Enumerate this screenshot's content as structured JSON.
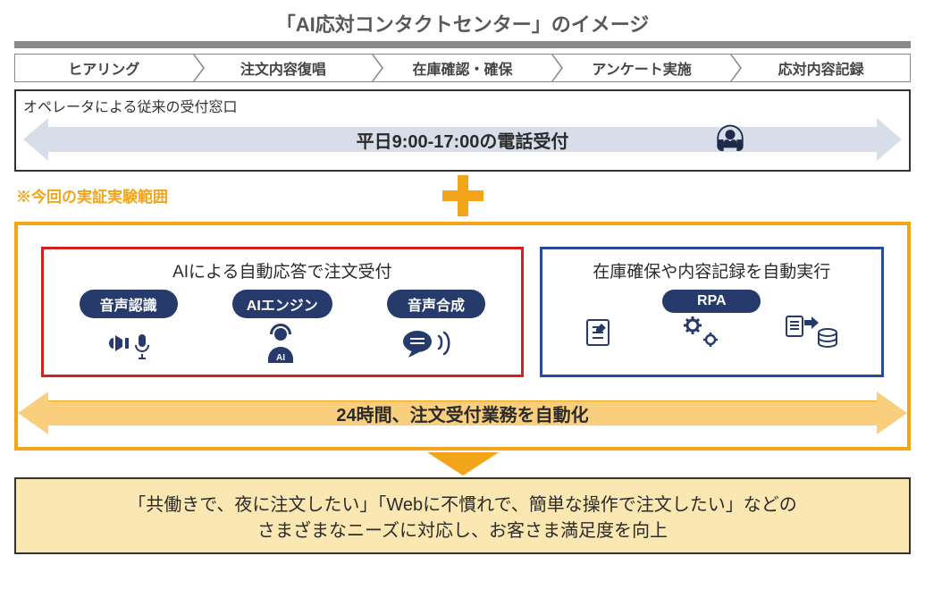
{
  "title": "「AI応対コンタクトセンター」のイメージ",
  "steps": [
    "ヒアリング",
    "注文内容復唱",
    "在庫確認・確保",
    "アンケート実施",
    "応対内容記録"
  ],
  "operator": {
    "caption": "オペレータによる従来の受付窓口",
    "hours": "平日9:00-17:00の電話受付"
  },
  "note": "※今回の実証実験範囲",
  "ai_panel": {
    "title": "AIによる自動応答で注文受付",
    "badges": [
      "音声認識",
      "AIエンジン",
      "音声合成"
    ]
  },
  "rpa_panel": {
    "title": "在庫確保や内容記録を自動実行",
    "badge": "RPA"
  },
  "wide_arrow": "24時間、注文受付業務を自動化",
  "result": {
    "line1": "「共働きで、夜に注文したい」「Webに不慣れで、簡単な操作で注文したい」などの",
    "line2": "さまざまなニーズに対応し、お客さま満足度を向上"
  }
}
